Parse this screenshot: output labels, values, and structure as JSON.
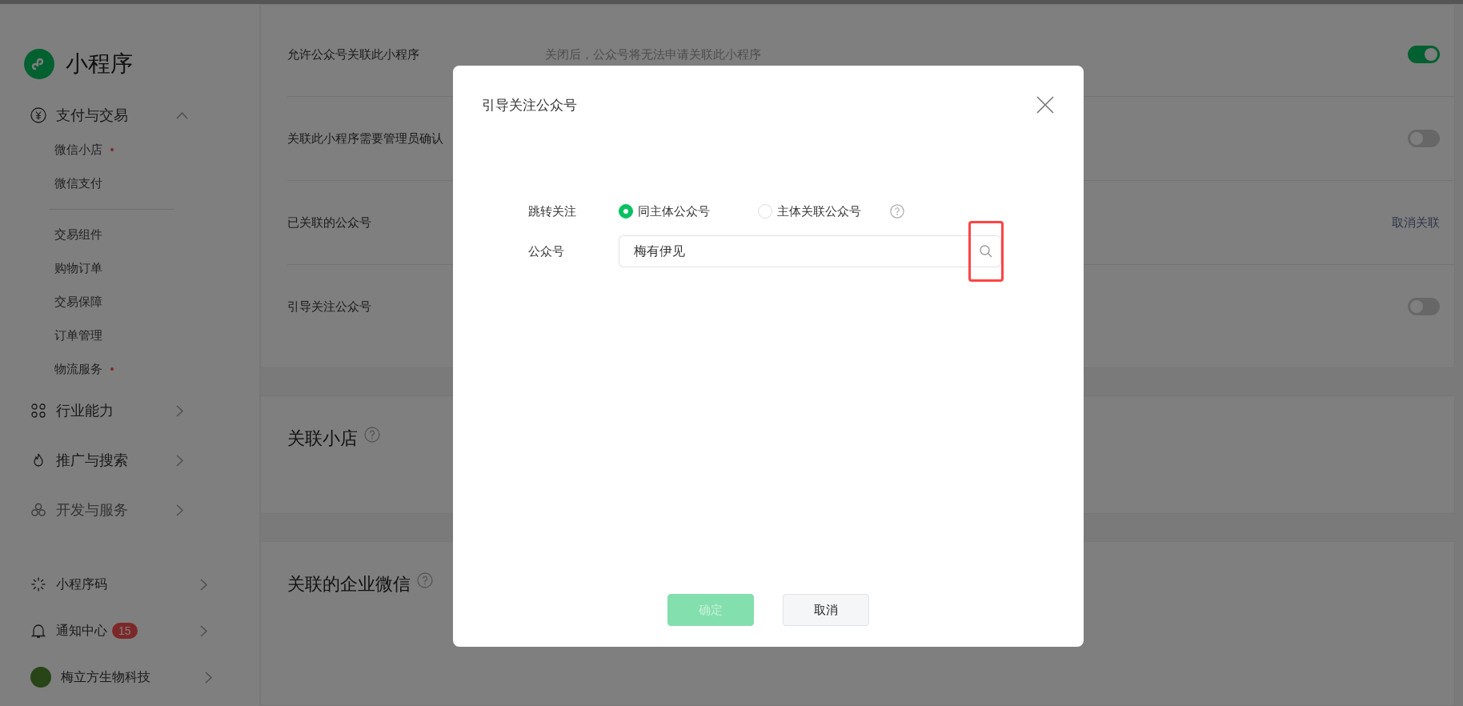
{
  "sidebar": {
    "title": "小程序",
    "groups": [
      {
        "label": "支付与交易",
        "expanded": true,
        "sections": [
          {
            "items": [
              {
                "label": "微信小店",
                "dot": true
              },
              {
                "label": "微信支付",
                "dot": false
              }
            ]
          },
          {
            "items": [
              {
                "label": "交易组件",
                "dot": false
              },
              {
                "label": "购物订单",
                "dot": false
              },
              {
                "label": "交易保障",
                "dot": false
              },
              {
                "label": "订单管理",
                "dot": false
              },
              {
                "label": "物流服务",
                "dot": true
              }
            ]
          }
        ]
      },
      {
        "label": "行业能力",
        "expanded": false
      },
      {
        "label": "推广与搜索",
        "expanded": false
      },
      {
        "label": "开发与服务",
        "expanded": false
      }
    ],
    "bottom": [
      {
        "kind": "code",
        "label": "小程序码"
      },
      {
        "kind": "notice",
        "label": "通知中心",
        "badge": "15"
      },
      {
        "kind": "account",
        "label": "梅立方生物科技"
      }
    ]
  },
  "settings": {
    "rows": [
      {
        "label": "允许公众号关联此小程序",
        "description": "关闭后，公众号将无法申请关联此小程序",
        "kind": "switch",
        "on": true
      },
      {
        "label": "关联此小程序需要管理员确认",
        "kind": "switch",
        "on": false
      },
      {
        "label": "已关联的公众号",
        "kind": "link",
        "link": "取消关联"
      },
      {
        "label": "引导关注公众号",
        "kind": "switch",
        "on": false
      }
    ]
  },
  "sections": [
    {
      "title": "关联小店",
      "help": true
    },
    {
      "title": "关联的企业微信",
      "help": true
    }
  ],
  "dialog": {
    "title": "引导关注公众号",
    "jump": {
      "label": "跳转关注",
      "options": [
        {
          "label": "同主体公众号",
          "selected": true,
          "help": false
        },
        {
          "label": "主体关联公众号",
          "selected": false,
          "help": true
        }
      ]
    },
    "account": {
      "label": "公众号",
      "value": "梅有伊见"
    },
    "buttons": [
      {
        "label": "确定",
        "kind": "primary",
        "disabled": true
      },
      {
        "label": "取消",
        "kind": "default",
        "disabled": false
      }
    ]
  }
}
